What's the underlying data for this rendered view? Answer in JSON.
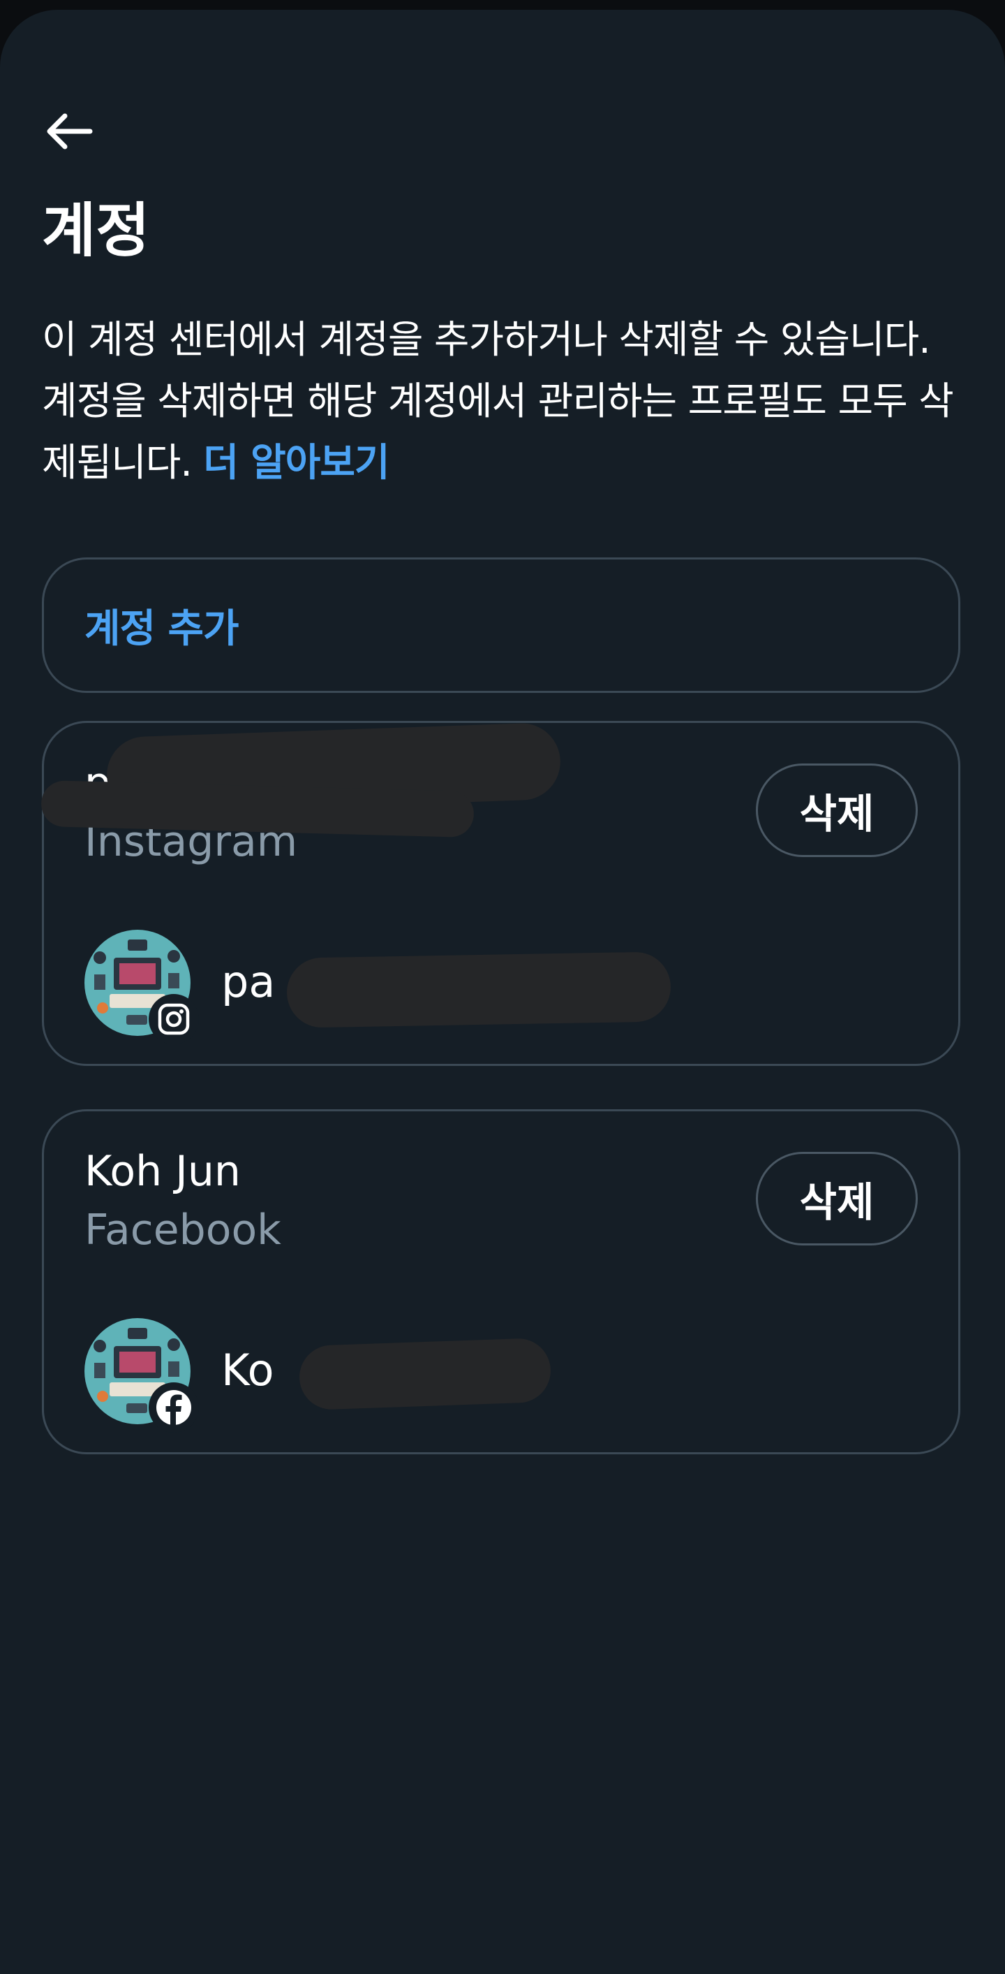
{
  "header": {
    "back_icon": "arrow-left-icon",
    "title": "계정",
    "description": "이 계정 센터에서 계정을 추가하거나 삭제할 수 있습니다. 계정을 삭제하면 해당 계정에서 관리하는 프로필도 모두 삭제됩니다.",
    "learn_more": "더 알아보기"
  },
  "add_account": {
    "label": "계정 추가"
  },
  "accounts": [
    {
      "name": "pa",
      "platform": "Instagram",
      "delete_label": "삭제",
      "profile_name": "pa",
      "badge_icon": "instagram-icon"
    },
    {
      "name": "Koh Jun",
      "platform": "Facebook",
      "delete_label": "삭제",
      "profile_name": "Ko",
      "badge_icon": "facebook-icon"
    }
  ],
  "colors": {
    "background": "#151e26",
    "accent": "#4ca3f4",
    "card_border": "#3b4955",
    "muted_text": "#8a9ba9"
  }
}
